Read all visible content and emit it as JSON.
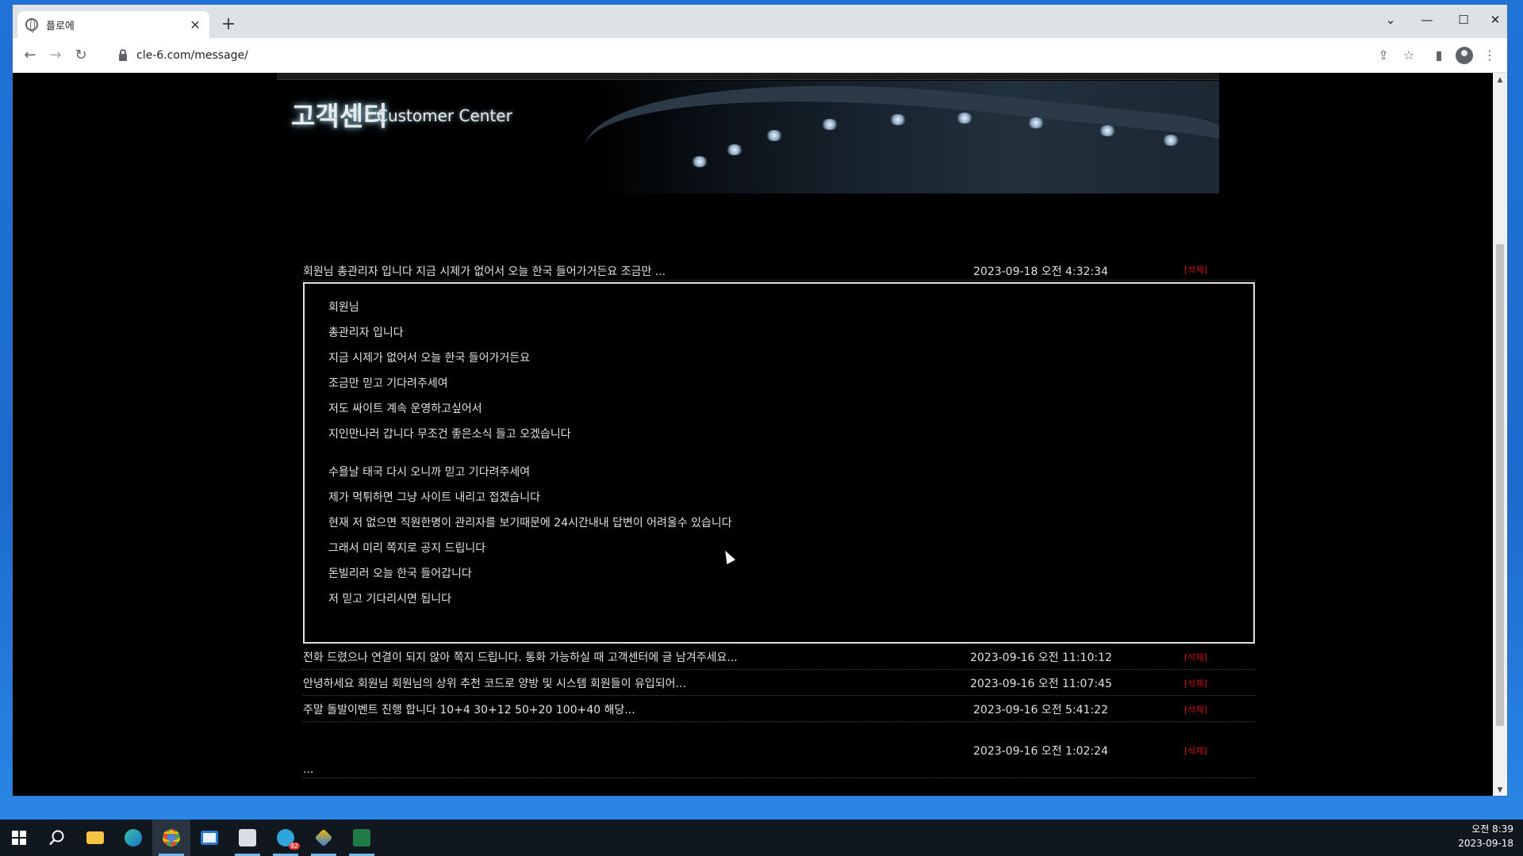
{
  "browser": {
    "tab_title": "플로에",
    "tab_close": "✕",
    "new_tab": "+",
    "url": "cle-6.com/message/",
    "back": "←",
    "forward": "→",
    "reload": "↻",
    "window_controls": {
      "menu": "⌄",
      "minimize": "—",
      "maximize": "☐",
      "close": "✕"
    },
    "toolbar_icons": {
      "share": "⇪",
      "bookmark": "☆",
      "sidepanel": "▮",
      "menu": "⋮"
    }
  },
  "page": {
    "banner_title": "고객센터",
    "banner_subtitle": "Customer Center",
    "messages": [
      {
        "subject": "회원님 총관리자 입니다 지금 시제가 없어서 오늘 한국 들어가거든요 조금만 ...",
        "date": "2023-09-18 오전 4:32:34",
        "delete_label": "[삭제]",
        "expanded": true,
        "body_lines": [
          "회원님",
          "총관리자 입니다",
          "지금 시제가 없어서 오늘 한국 들어가거든요",
          "조금만 믿고 기다려주세여",
          "저도 싸이트 계속 운영하고싶어서",
          "지인만나러 갑니다 무조건 좋은소식 들고 오겠습니다",
          "",
          "수욜날 태국 다시 오니까 믿고 기다려주세여",
          "제가 먹튀하면 그냥 사이트 내리고 접겠습니다",
          "현재 저 없으면 직원한명이 관리자를 보기때문에 24시간내내 답변이 어려울수 있습니다",
          "그래서 미리 쪽지로 공지 드립니다",
          "돈빌리러 오늘 한국 들어갑니다",
          "저 믿고 기다리시면 됩니다"
        ]
      },
      {
        "subject": "전화 드렸으나 연결이 되지 않아 쪽지 드립니다. 통화 가능하실 때 고객센터에 글 남겨주세요...",
        "date": "2023-09-16 오전 11:10:12",
        "delete_label": "[삭제]"
      },
      {
        "subject": "안녕하세요 회원님 회원님의 상위 추천 코드로 양방 및 시스템 회원들이 유입되어...",
        "date": "2023-09-16 오전 11:07:45",
        "delete_label": "[삭제]"
      },
      {
        "subject": "주말 돌발이벤트 진행 합니다 10+4 30+12 50+20 100+40 해당...",
        "date": "2023-09-16 오전 5:41:22",
        "delete_label": "[삭제]"
      },
      {
        "subject": "...",
        "date": "2023-09-16 오전 1:02:24",
        "delete_label": "[삭제]"
      }
    ]
  },
  "taskbar": {
    "time": "오전 8:39",
    "date": "2023-09-18",
    "telegram_badge": "92"
  }
}
